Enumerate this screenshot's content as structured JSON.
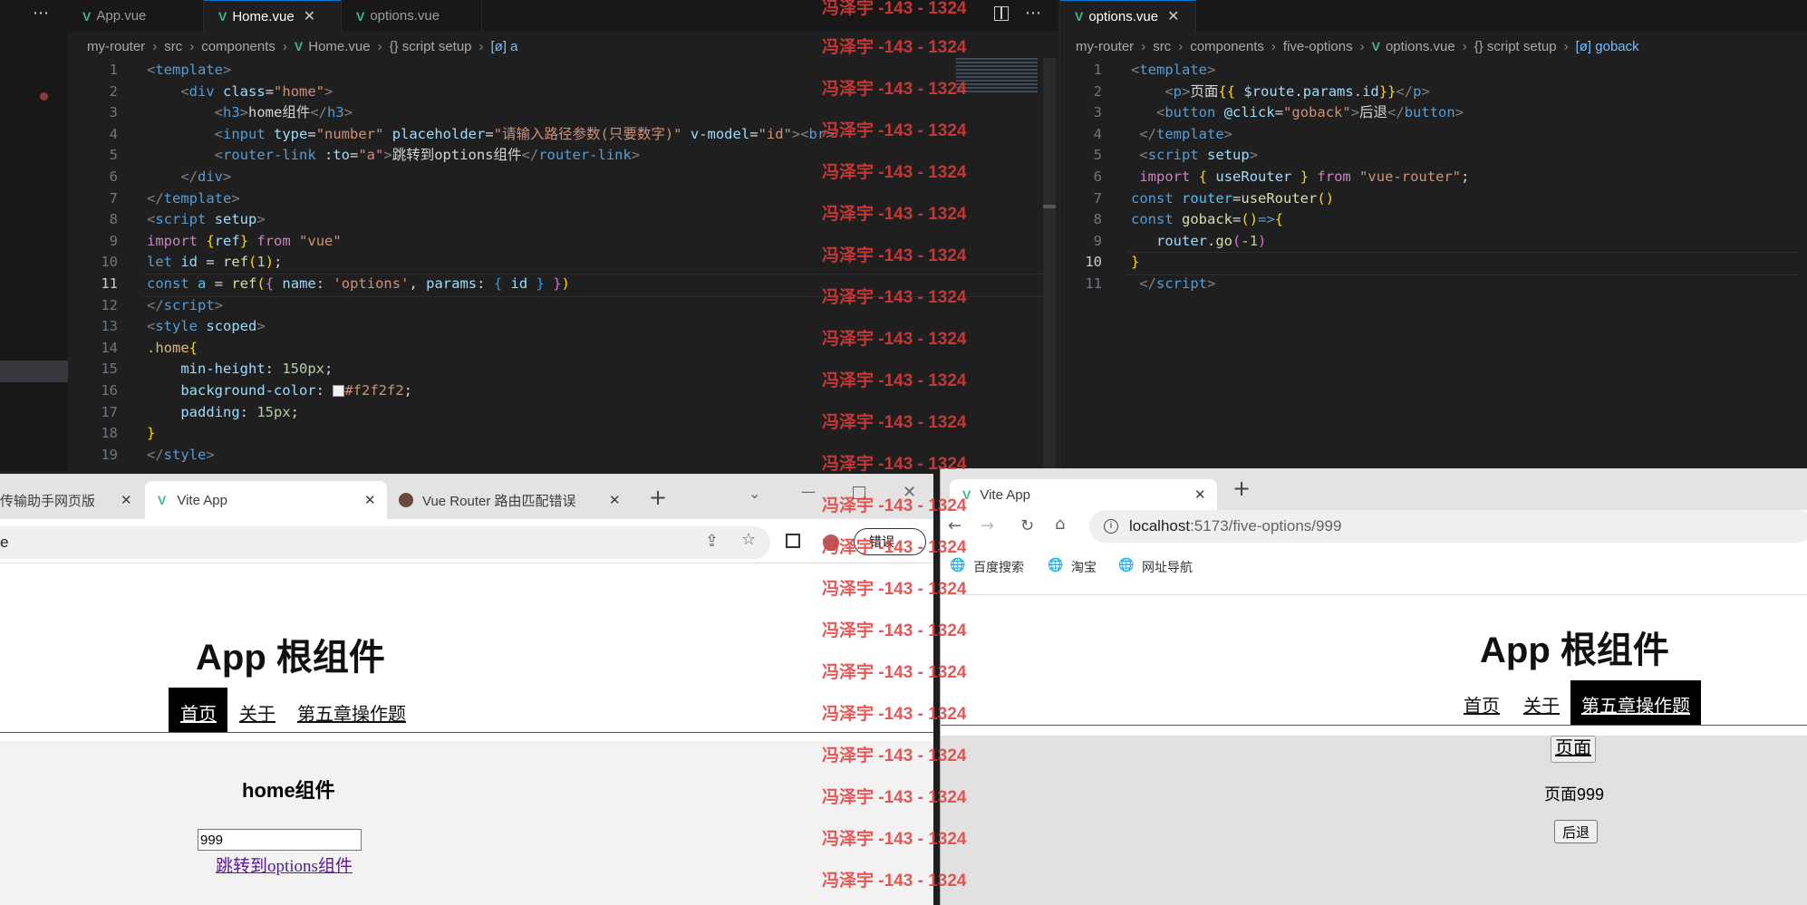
{
  "left_editor": {
    "more_icon": "⋯",
    "tabs": [
      {
        "label": "App.vue"
      },
      {
        "label": "Home.vue"
      },
      {
        "label": "options.vue"
      }
    ],
    "breadcrumb": [
      "my-router",
      "src",
      "components",
      "Home.vue",
      "{} script setup",
      "[ø] a"
    ],
    "current_line": "11",
    "lines": [
      "1",
      "2",
      "3",
      "4",
      "5",
      "6",
      "7",
      "8",
      "9",
      "10",
      "11",
      "12",
      "13",
      "14",
      "15",
      "16",
      "17",
      "18",
      "19"
    ]
  },
  "right_editor": {
    "tabs": [
      {
        "label": "options.vue"
      }
    ],
    "breadcrumb": [
      "my-router",
      "src",
      "components",
      "five-options",
      "options.vue",
      "{} script setup",
      "[ø] goback"
    ],
    "current_line": "10",
    "lines": [
      "1",
      "2",
      "3",
      "4",
      "5",
      "6",
      "7",
      "8",
      "9",
      "10",
      "11"
    ]
  },
  "left_browser": {
    "tabs": [
      {
        "label": "传输助手网页版"
      },
      {
        "label": "Vite App"
      },
      {
        "label": "Vue Router 路由匹配错误"
      }
    ],
    "address": "e",
    "error_badge": "错误",
    "app_title": "App 根组件",
    "nav": [
      "首页",
      "关于",
      "第五章操作题"
    ],
    "active_nav": 0,
    "content_title": "home组件",
    "input_value": "999",
    "input_placeholder": "请输入路径参数(只要数字)",
    "link_text": "跳转到options组件"
  },
  "right_browser": {
    "tabs": [
      {
        "label": "Vite App"
      }
    ],
    "address_host": "localhost",
    "address_rest": ":5173/five-options/999",
    "bookmarks": [
      "百度搜索",
      "淘宝",
      "网址导航"
    ],
    "app_title": "App 根组件",
    "nav": [
      "首页",
      "关于",
      "第五章操作题"
    ],
    "active_nav": 2,
    "page_button": "页面",
    "page_text": "页面999",
    "back_button": "后退"
  },
  "watermark": "冯泽宇 -143 - 1324",
  "colors": {
    "editor_bg": "#1f1f1f",
    "vue_green": "#41b883",
    "watermark_red": "#e03c3c",
    "accent": "#0078d4"
  }
}
